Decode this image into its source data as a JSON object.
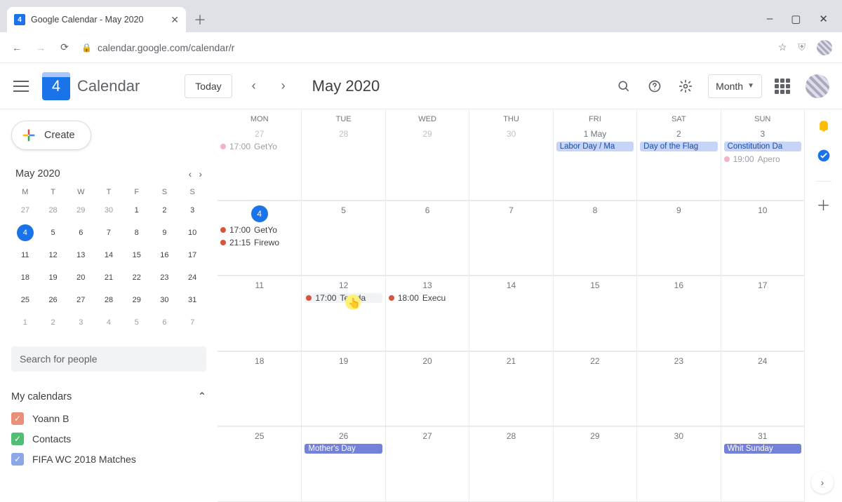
{
  "browser": {
    "tab_title": "Google Calendar - May 2020",
    "url": "calendar.google.com/calendar/r",
    "favicon_text": "4"
  },
  "header": {
    "app_name": "Calendar",
    "logo_day": "4",
    "today_label": "Today",
    "month_title": "May 2020",
    "view_label": "Month"
  },
  "sidebar": {
    "create_label": "Create",
    "minical_title": "May 2020",
    "dow": [
      "M",
      "T",
      "W",
      "T",
      "F",
      "S",
      "S"
    ],
    "mini_days": [
      {
        "n": "27",
        "o": true
      },
      {
        "n": "28",
        "o": true
      },
      {
        "n": "29",
        "o": true
      },
      {
        "n": "30",
        "o": true
      },
      {
        "n": "1"
      },
      {
        "n": "2"
      },
      {
        "n": "3"
      },
      {
        "n": "4",
        "today": true
      },
      {
        "n": "5"
      },
      {
        "n": "6"
      },
      {
        "n": "7"
      },
      {
        "n": "8"
      },
      {
        "n": "9"
      },
      {
        "n": "10"
      },
      {
        "n": "11"
      },
      {
        "n": "12"
      },
      {
        "n": "13"
      },
      {
        "n": "14"
      },
      {
        "n": "15"
      },
      {
        "n": "16"
      },
      {
        "n": "17"
      },
      {
        "n": "18"
      },
      {
        "n": "19"
      },
      {
        "n": "20"
      },
      {
        "n": "21"
      },
      {
        "n": "22"
      },
      {
        "n": "23"
      },
      {
        "n": "24"
      },
      {
        "n": "25"
      },
      {
        "n": "26"
      },
      {
        "n": "27"
      },
      {
        "n": "28"
      },
      {
        "n": "29"
      },
      {
        "n": "30"
      },
      {
        "n": "31"
      },
      {
        "n": "1",
        "o": true
      },
      {
        "n": "2",
        "o": true
      },
      {
        "n": "3",
        "o": true
      },
      {
        "n": "4",
        "o": true
      },
      {
        "n": "5",
        "o": true
      },
      {
        "n": "6",
        "o": true
      },
      {
        "n": "7",
        "o": true
      }
    ],
    "search_placeholder": "Search for people",
    "mycal_label": "My calendars",
    "calendars": [
      {
        "name": "Yoann B",
        "color": "#ea8f7a"
      },
      {
        "name": "Contacts",
        "color": "#4fbf74"
      },
      {
        "name": "FIFA WC 2018 Matches",
        "color": "#8ba7e8"
      }
    ]
  },
  "grid": {
    "dow": [
      "MON",
      "TUE",
      "WED",
      "THU",
      "FRI",
      "SAT",
      "SUN"
    ],
    "weeks": [
      [
        {
          "num": "27",
          "other": true,
          "events": [
            {
              "type": "dot",
              "color": "pink",
              "time": "17:00",
              "title": "GetYo",
              "faded": true
            }
          ]
        },
        {
          "num": "28",
          "other": true
        },
        {
          "num": "29",
          "other": true
        },
        {
          "num": "30",
          "other": true
        },
        {
          "num": "1 May",
          "events": [
            {
              "type": "chip",
              "title": "Labor Day / Ma"
            }
          ]
        },
        {
          "num": "2",
          "events": [
            {
              "type": "chip",
              "title": "Day of the Flag"
            }
          ]
        },
        {
          "num": "3",
          "events": [
            {
              "type": "chip",
              "title": "Constitution Da"
            },
            {
              "type": "dot",
              "color": "pink",
              "time": "19:00",
              "title": "Apero",
              "faded": true
            }
          ]
        }
      ],
      [
        {
          "num": "4",
          "today": true,
          "events": [
            {
              "type": "dot",
              "color": "red",
              "time": "17:00",
              "title": "GetYo"
            },
            {
              "type": "dot",
              "color": "red",
              "time": "21:15",
              "title": "Firewo"
            }
          ]
        },
        {
          "num": "5"
        },
        {
          "num": "6"
        },
        {
          "num": "7"
        },
        {
          "num": "8"
        },
        {
          "num": "9"
        },
        {
          "num": "10"
        }
      ],
      [
        {
          "num": "11"
        },
        {
          "num": "12",
          "events": [
            {
              "type": "dot",
              "color": "red",
              "time": "17:00",
              "title": "Terada",
              "hover": true,
              "cursor": true
            }
          ]
        },
        {
          "num": "13",
          "events": [
            {
              "type": "dot",
              "color": "red",
              "time": "18:00",
              "title": "Execu"
            }
          ]
        },
        {
          "num": "14"
        },
        {
          "num": "15"
        },
        {
          "num": "16"
        },
        {
          "num": "17"
        }
      ],
      [
        {
          "num": "18"
        },
        {
          "num": "19"
        },
        {
          "num": "20"
        },
        {
          "num": "21"
        },
        {
          "num": "22"
        },
        {
          "num": "23"
        },
        {
          "num": "24"
        }
      ],
      [
        {
          "num": "25"
        },
        {
          "num": "26",
          "events": [
            {
              "type": "chip",
              "style": "indigo",
              "title": "Mother's Day"
            }
          ]
        },
        {
          "num": "27"
        },
        {
          "num": "28"
        },
        {
          "num": "29"
        },
        {
          "num": "30"
        },
        {
          "num": "31",
          "events": [
            {
              "type": "chip",
              "style": "indigo",
              "title": "Whit Sunday"
            }
          ]
        }
      ]
    ]
  }
}
